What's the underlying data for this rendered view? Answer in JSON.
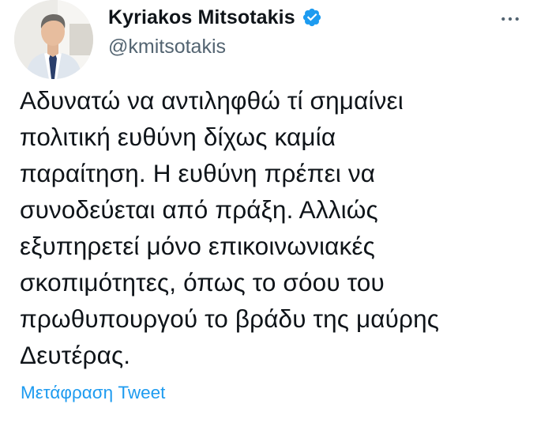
{
  "author": {
    "display_name": "Kyriakos Mitsotakis",
    "handle": "@kmitsotakis",
    "verified": true,
    "avatar_icon": "profile-photo"
  },
  "tweet": {
    "text": "Αδυνατώ να αντιληφθώ τί σημαίνει\nπολιτική ευθύνη δίχως καμία\nπαραίτηση. Η ευθύνη πρέπει να\nσυνοδεύεται από πράξη. Αλλιώς\nεξυπηρετεί μόνο επικοινωνιακές\nσκοπιμότητες, όπως το σόου του\nπρωθυπουργού το βράδυ της μαύρης\nΔευτέρας."
  },
  "actions": {
    "translate_label": "Μετάφραση Tweet",
    "more_icon": "more-horizontal-icon"
  },
  "colors": {
    "text": "#0f1419",
    "secondary": "#536471",
    "accent": "#1d9bf0"
  }
}
